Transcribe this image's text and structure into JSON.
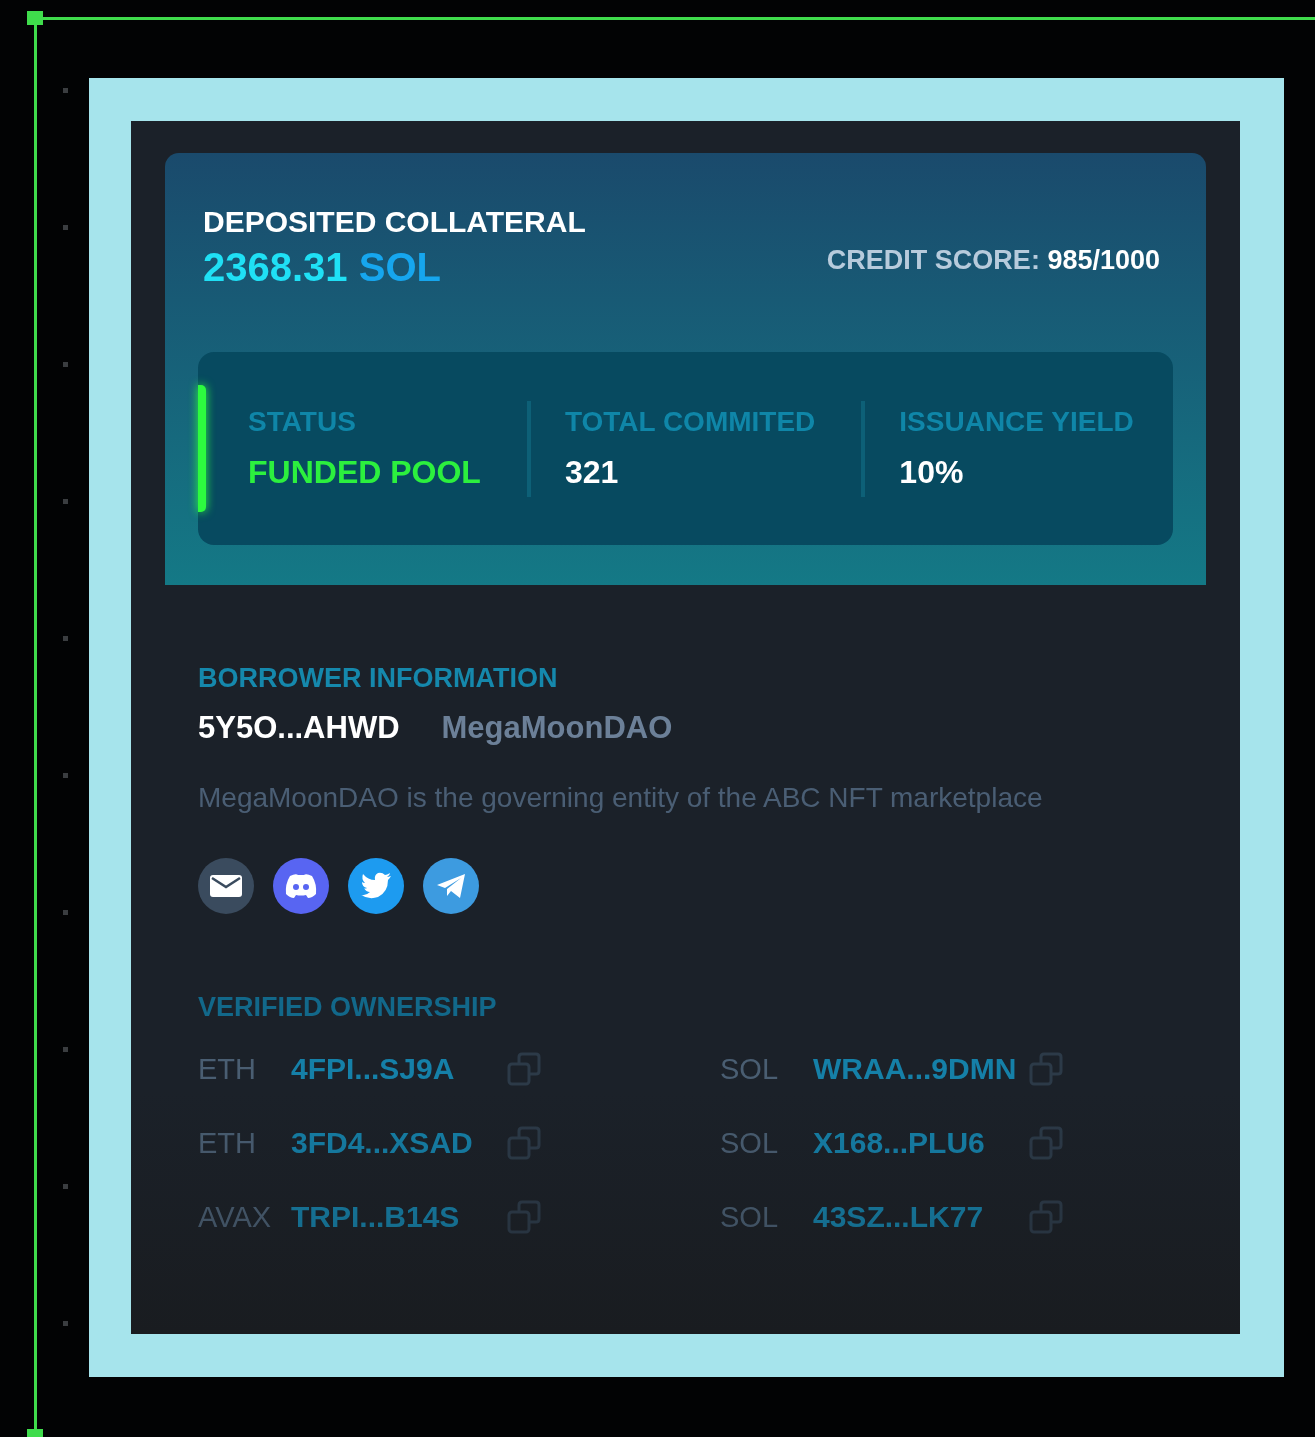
{
  "collateral": {
    "label": "DEPOSITED COLLATERAL",
    "amount": "2368.31",
    "unit": "SOL"
  },
  "credit_score": {
    "label": "CREDIT SCORE:",
    "value": "985/1000"
  },
  "stats": [
    {
      "label": "STATUS",
      "value": "FUNDED POOL",
      "kind": "status"
    },
    {
      "label": "TOTAL COMMITED",
      "value": "321",
      "kind": "number"
    },
    {
      "label": "ISSUANCE YIELD",
      "value": "10%",
      "kind": "number"
    }
  ],
  "borrower": {
    "heading": "BORROWER INFORMATION",
    "address": "5Y5O...AHWD",
    "name": "MegaMoonDAO",
    "description": "MegaMoonDAO is the governing entity of the ABC NFT marketplace",
    "socials": [
      {
        "kind": "email"
      },
      {
        "kind": "discord"
      },
      {
        "kind": "twitter"
      },
      {
        "kind": "telegram"
      }
    ]
  },
  "ownership": {
    "heading": "VERIFIED OWNERSHIP",
    "wallets": [
      {
        "chain": "ETH",
        "address": "4FPI...SJ9A"
      },
      {
        "chain": "SOL",
        "address": "WRAA...9DMN"
      },
      {
        "chain": "ETH",
        "address": "3FD4...XSAD"
      },
      {
        "chain": "SOL",
        "address": "X168...PLU6"
      },
      {
        "chain": "AVAX",
        "address": "TRPI...B14S"
      },
      {
        "chain": "SOL",
        "address": "43SZ...LK77"
      }
    ]
  }
}
